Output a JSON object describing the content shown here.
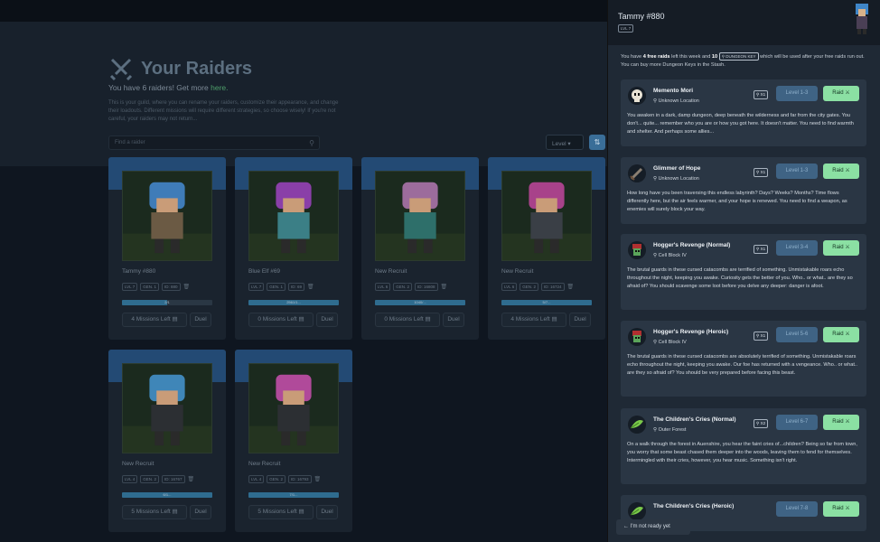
{
  "page": {
    "title": "Your Raiders",
    "subtitle_prefix": "You have 6 raiders! Get more",
    "subtitle_link": "here.",
    "description": "This is your guild, where you can rename your raiders, customize their appearance, and change their loadouts. Different missions will require different strategies, so choose wisely! If you're not careful, your raiders may not return...",
    "search_placeholder": "Find a raider",
    "sort_select": "Level"
  },
  "raiders": [
    {
      "name": "Tammy #880",
      "lvl": "LVL 7",
      "gen": "GEN. 1",
      "id": "ID: 880",
      "xp": "2/1",
      "xp_pct": 0.5,
      "missions": "4 Missions Left",
      "duel": "Duel",
      "hair": "#3f7cb8",
      "cloth": "#6b5a44"
    },
    {
      "name": "Blue Elf #69",
      "lvl": "LVL 7",
      "gen": "GEN. 1",
      "id": "ID: 69",
      "xp": "2561/1...",
      "xp_pct": 1.0,
      "missions": "0 Missions Left",
      "duel": "Duel",
      "hair": "#8a3fa8",
      "cloth": "#3b7f86"
    },
    {
      "name": "New Recruit",
      "lvl": "LVL 6",
      "gen": "GEN. 2",
      "id": "ID: 16808",
      "xp": "1040/...",
      "xp_pct": 1.0,
      "missions": "0 Missions Left",
      "duel": "Duel",
      "hair": "#9c6c9c",
      "cloth": "#2e6f6a"
    },
    {
      "name": "New Recruit",
      "lvl": "LVL 6",
      "gen": "GEN. 2",
      "id": "ID: 16724",
      "xp": "5/7...",
      "xp_pct": 1.0,
      "missions": "4 Missions Left",
      "duel": "Duel",
      "hair": "#a8428a",
      "cloth": "#3a3f46"
    },
    {
      "name": "New Recruit",
      "lvl": "LVL 4",
      "gen": "GEN. 2",
      "id": "ID: 16767",
      "xp": "6/1...",
      "xp_pct": 1.0,
      "missions": "5 Missions Left",
      "duel": "Duel",
      "hair": "#3f86b8",
      "cloth": "#2c2f33"
    },
    {
      "name": "New Recruit",
      "lvl": "LVL 4",
      "gen": "GEN. 2",
      "id": "ID: 16793",
      "xp": "7/1...",
      "xp_pct": 1.0,
      "missions": "5 Missions Left",
      "duel": "Duel",
      "hair": "#b04a9a",
      "cloth": "#2c2f33"
    }
  ],
  "panel": {
    "raider_name": "Tammy #880",
    "raider_level": "LVL 7",
    "info_1": "You have",
    "info_free": "4 free raids",
    "info_2": "left this week and",
    "info_keys": "10",
    "info_key_badge": "DUNGEON KEY",
    "info_3": "which will be used after your free raids run out. You can buy more Dungeon Keys in the Stash.",
    "back_button": "I'm not ready yet"
  },
  "raids": [
    {
      "name": "Memento Mori",
      "location": "Unknown Location",
      "keys": "X1",
      "level": "Level 1-3",
      "button": "Raid",
      "icon": "skull",
      "desc": "You awaken in a dark, damp dungeon, deep beneath the wilderness and far from the city gates. You don't... quite... remember who you are or how you got here. It doesn't matter. You need to find warmth and shelter. And perhaps some allies..."
    },
    {
      "name": "Glimmer of Hope",
      "location": "Unknown Location",
      "keys": "X1",
      "level": "Level 1-3",
      "button": "Raid",
      "icon": "sword",
      "desc": "How long have you been traversing this endless labyrinth? Days? Weeks? Months? Time flows differently here, but the air feels warmer, and your hope is renewed. You need to find a weapon, as enemies will surely block your way."
    },
    {
      "name": "Hogger's Revenge (Normal)",
      "location": "Cell Block IV",
      "keys": "X1",
      "level": "Level 3-4",
      "button": "Raid",
      "icon": "goblin",
      "desc": "The brutal guards in these cursed catacombs are terrified of something. Unmistakable roars echo throughout the night, keeping you awake. Curiosity gets the better of you. Who.. or what.. are they so afraid of? You should scavenge some loot before you delve any deeper: danger is afoot."
    },
    {
      "name": "Hogger's Revenge (Heroic)",
      "location": "Cell Block IV",
      "keys": "X1",
      "level": "Level 5-6",
      "button": "Raid",
      "icon": "goblin",
      "desc": "The brutal guards in these cursed catacombs are absolutely terrified of something. Unmistakable roars echo throughout the night, keeping you awake. Our foe has returned with a vengeance. Who.. or what.. are they so afraid of? You should be very prepared before facing this beast."
    },
    {
      "name": "The Children's Cries (Normal)",
      "location": "Outer Forest",
      "keys": "X2",
      "level": "Level 6-7",
      "button": "Raid",
      "icon": "leaf",
      "desc": "On a walk through the forest in Auenshire, you hear the faint cries of...children? Being so far from town, you worry that some beast chased them deeper into the woods, leaving them to fend for themselves. Intermingled with their cries, however, you hear music. Something isn't right."
    },
    {
      "name": "The Children's Cries (Heroic)",
      "location": "",
      "keys": "",
      "level": "Level 7-8",
      "button": "Raid",
      "icon": "leaf",
      "desc": ""
    }
  ]
}
